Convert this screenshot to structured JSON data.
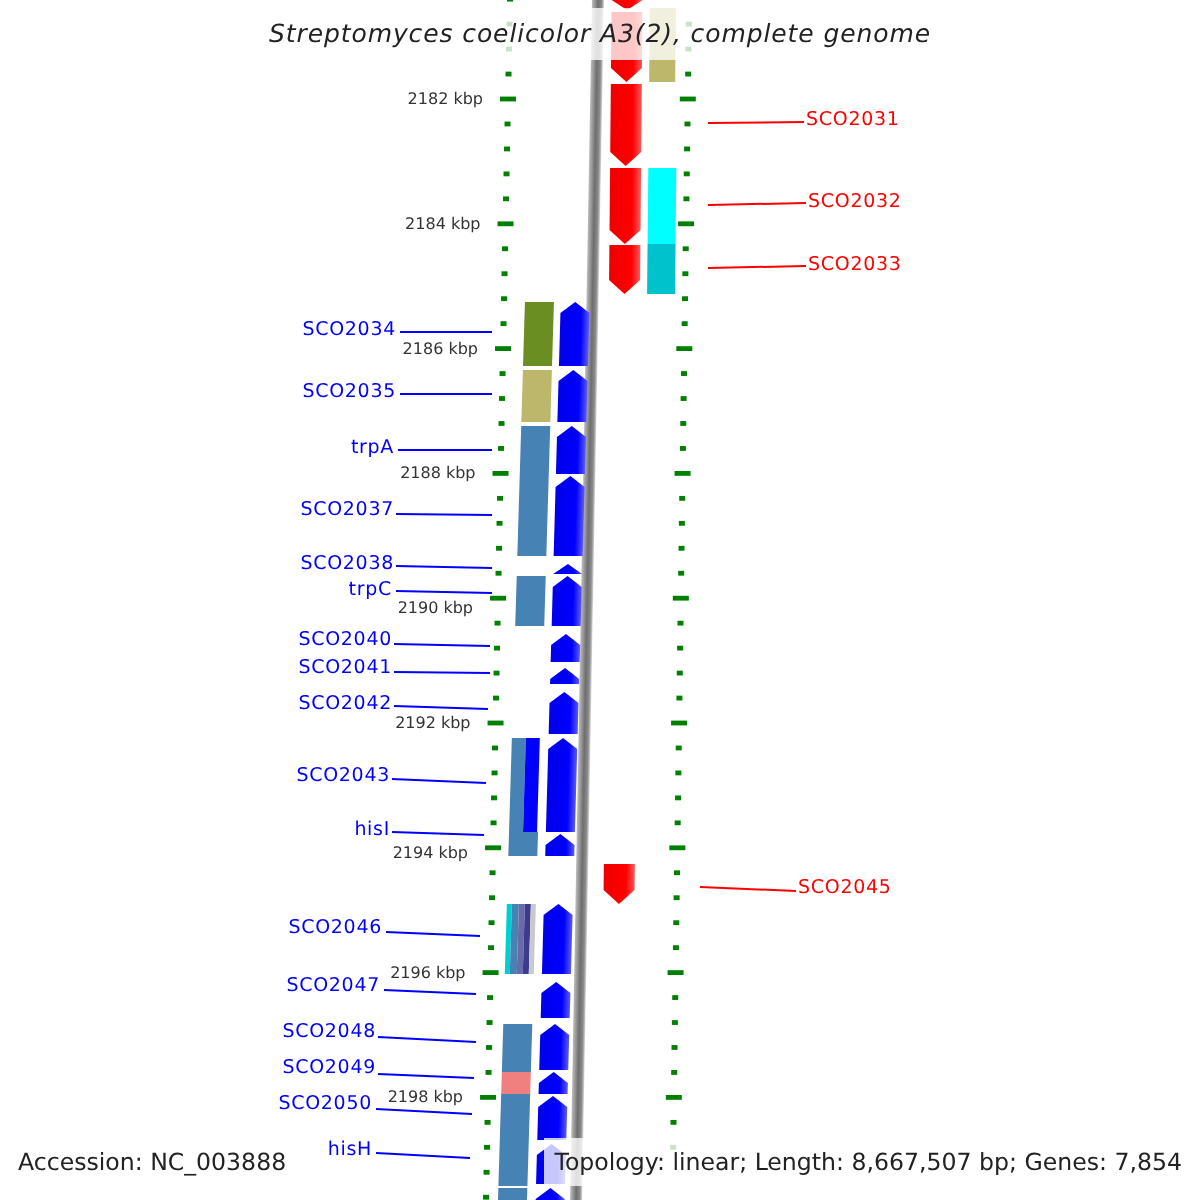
{
  "title": "Streptomyces coelicolor A3(2), complete genome",
  "scale": [
    "2182 kbp",
    "2184 kbp",
    "2186 kbp",
    "2188 kbp",
    "2190 kbp",
    "2192 kbp",
    "2194 kbp",
    "2196 kbp",
    "2198 kbp"
  ],
  "genes": [
    {
      "kind": "forward"
    },
    {
      "kind": "forward"
    },
    {
      "label": "SCO2031",
      "kind": "forward"
    },
    {
      "label": "SCO2032",
      "kind": "forward"
    },
    {
      "label": "SCO2033",
      "kind": "forward"
    },
    {
      "label": "SCO2034",
      "kind": "reverse"
    },
    {
      "label": "SCO2035",
      "kind": "reverse"
    },
    {
      "label": "trpA",
      "kind": "reverse"
    },
    {
      "label": "SCO2037",
      "kind": "reverse"
    },
    {
      "label": "SCO2038",
      "kind": "reverse"
    },
    {
      "label": "trpC",
      "kind": "reverse"
    },
    {
      "label": "SCO2040",
      "kind": "reverse"
    },
    {
      "label": "SCO2041",
      "kind": "reverse"
    },
    {
      "label": "SCO2042",
      "kind": "reverse"
    },
    {
      "label": "SCO2043",
      "kind": "reverse"
    },
    {
      "label": "hisI",
      "kind": "reverse"
    },
    {
      "label": "SCO2045",
      "kind": "forward"
    },
    {
      "label": "SCO2046",
      "kind": "reverse"
    },
    {
      "label": "SCO2047",
      "kind": "reverse"
    },
    {
      "label": "SCO2048",
      "kind": "reverse"
    },
    {
      "label": "SCO2049",
      "kind": "reverse"
    },
    {
      "label": "SCO2050",
      "kind": "reverse"
    },
    {
      "label": "hisH",
      "kind": "reverse"
    },
    {
      "kind": "reverse"
    }
  ],
  "features": [
    {
      "color": "#bdb76b"
    },
    {
      "color": "#00ffff"
    },
    {
      "color": "#00c2cc"
    },
    {
      "color": "#6b8e23"
    },
    {
      "color": "#bdb76b"
    },
    {
      "color": "#4682b4"
    },
    {
      "color": "#4682b4"
    },
    {
      "color": "#4682b4"
    },
    {
      "color": "#0000ff"
    },
    {
      "color": "#4682b4"
    },
    {
      "color": "#00ced1"
    },
    {
      "color": "#4682b4"
    },
    {
      "color": "#6a6aaa"
    },
    {
      "color": "#3c3c8c"
    },
    {
      "color": "#c8c8d0"
    },
    {
      "color": "#4682b4"
    },
    {
      "color": "#f08080"
    },
    {
      "color": "#4682b4"
    },
    {
      "color": "#4682b4"
    },
    {
      "color": "#4682b4"
    }
  ],
  "footer": {
    "accession": "Accession: NC_003888",
    "summary": "Topology: linear; Length: 8,667,507 bp; Genes: 7,854"
  }
}
